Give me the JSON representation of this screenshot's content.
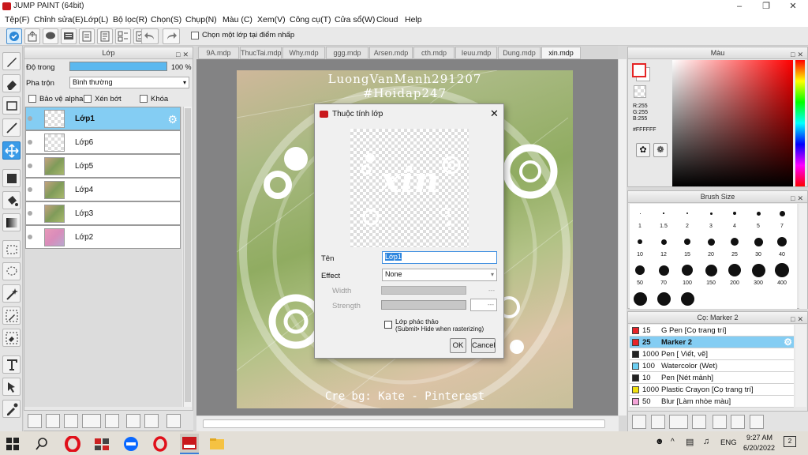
{
  "window": {
    "title": "JUMP PAINT (64bit)"
  },
  "menu": [
    "Tệp(F)",
    "Chỉnh sửa(E)",
    "Lớp(L)",
    "Bộ lọc(R)",
    "Chọn(S)",
    "Chụp(N)",
    "Màu (C)",
    "Xem(V)",
    "Công cụ(T)",
    "Cửa sổ(W)",
    "Cloud",
    "Help"
  ],
  "toolbar": {
    "snap_label": "Chọn một lớp tại điểm nhấp"
  },
  "layers": {
    "title": "Lớp",
    "opacity_label": "Độ trong",
    "opacity_value": "100 %",
    "opacity_fraction": 1.0,
    "blend_label": "Pha trộn",
    "blend_value": "Bình thường",
    "protect_alpha": "Bảo vệ alpha",
    "clip": "Xén bớt",
    "lock": "Khóa",
    "items": [
      {
        "name": "Lớp1",
        "thumb": "transparent",
        "selected": true
      },
      {
        "name": "Lớp6",
        "thumb": "transparent",
        "selected": false
      },
      {
        "name": "Lớp5",
        "thumb": "green",
        "selected": false
      },
      {
        "name": "Lớp4",
        "thumb": "green",
        "selected": false
      },
      {
        "name": "Lớp3",
        "thumb": "green",
        "selected": false
      },
      {
        "name": "Lớp2",
        "thumb": "pink",
        "selected": false
      }
    ]
  },
  "tabs": [
    "9A.mdp",
    "ThucTai.mdp",
    "Why.mdp",
    "ggg.mdp",
    "Arsen.mdp",
    "cth.mdp",
    "Ieuu.mdp",
    "Dung.mdp",
    "xin.mdp"
  ],
  "active_tab": "xin.mdp",
  "artwork": {
    "line1": "LuongVanManh291207",
    "line2": "#Hoidap247",
    "credit": "Cre bg: Kate - Pinterest",
    "preview_text": "xin"
  },
  "dialog": {
    "title": "Thuộc tính lớp",
    "name_label": "Tên",
    "name_value": "Lớp1",
    "effect_label": "Effect",
    "effect_value": "None",
    "width_label": "Width",
    "width_value": "---",
    "strength_label": "Strength",
    "strength_value": "---",
    "draft_label": "Lớp phác thảo",
    "draft_sub": "(Submit• Hide when rasterizing)",
    "ok": "OK",
    "cancel": "Cancel"
  },
  "color": {
    "title": "Màu",
    "r": "R:255",
    "g": "G:255",
    "b": "B:255",
    "hex": "#FFFFFF",
    "primary": "#ffffff"
  },
  "brush_size": {
    "title": "Brush Size",
    "sizes": [
      "1",
      "1.5",
      "2",
      "3",
      "4",
      "5",
      "7",
      "10",
      "12",
      "15",
      "20",
      "25",
      "30",
      "40",
      "50",
      "70",
      "100",
      "150",
      "200",
      "300",
      "400"
    ]
  },
  "brushes": {
    "title": "Cọ: Marker 2",
    "items": [
      {
        "size": "15",
        "name": "G Pen [Cọ trang trí]",
        "color": "#e8242a",
        "selected": false
      },
      {
        "size": "25",
        "name": "Marker 2",
        "color": "#e8242a",
        "selected": true
      },
      {
        "size": "1000",
        "name": "Pen [ Viết, vẽ]",
        "color": "#222222",
        "selected": false
      },
      {
        "size": "100",
        "name": "Watercolor (Wet)",
        "color": "#6ccff2",
        "selected": false
      },
      {
        "size": "10",
        "name": "Pen [Nét mảnh]",
        "color": "#222222",
        "selected": false
      },
      {
        "size": "1000",
        "name": "Plastic Crayon [Cọ trang trí]",
        "color": "#f0e010",
        "selected": false
      },
      {
        "size": "50",
        "name": "Blur [Làm nhòe màu]",
        "color": "#f4a4d8",
        "selected": false
      }
    ]
  },
  "taskbar": {
    "time": "9:27 AM",
    "date": "6/20/2022",
    "lang": "ENG",
    "notifications": "2"
  }
}
